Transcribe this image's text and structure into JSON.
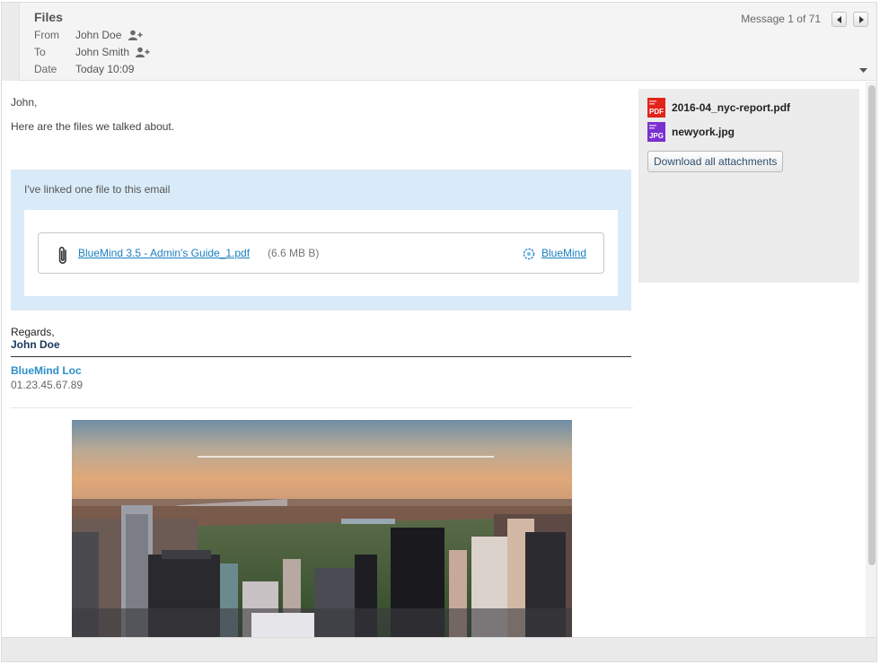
{
  "header": {
    "subject": "Files",
    "from_label": "From",
    "from_value": "John Doe",
    "to_label": "To",
    "to_value": "John Smith",
    "date_label": "Date",
    "date_value": "Today 10:09",
    "message_counter": "Message 1 of 71"
  },
  "body": {
    "greeting": "John,",
    "intro": "Here are the files we talked about.",
    "linked_note": "I've linked one file to this email",
    "linked_file": {
      "name": "BlueMind 3.5 - Admin's Guide_1.pdf",
      "size": "(6.6 MB B)",
      "provider": "BlueMind"
    },
    "regards": "Regards,",
    "signature_name": "John Doe",
    "company": "BlueMind Loc",
    "phone": "01.23.45.67.89"
  },
  "attachments": {
    "items": [
      {
        "name": "2016-04_nyc-report.pdf",
        "icon": "pdf-file-icon",
        "badge": "PDF"
      },
      {
        "name": "newyork.jpg",
        "icon": "jpg-file-icon",
        "badge": "JPG"
      }
    ],
    "download_all_label": "Download all attachments"
  },
  "colors": {
    "link": "#1a7fc0",
    "linkbox_bg": "#d9ebf9",
    "company": "#2c8fc9",
    "signature": "#17375e"
  }
}
